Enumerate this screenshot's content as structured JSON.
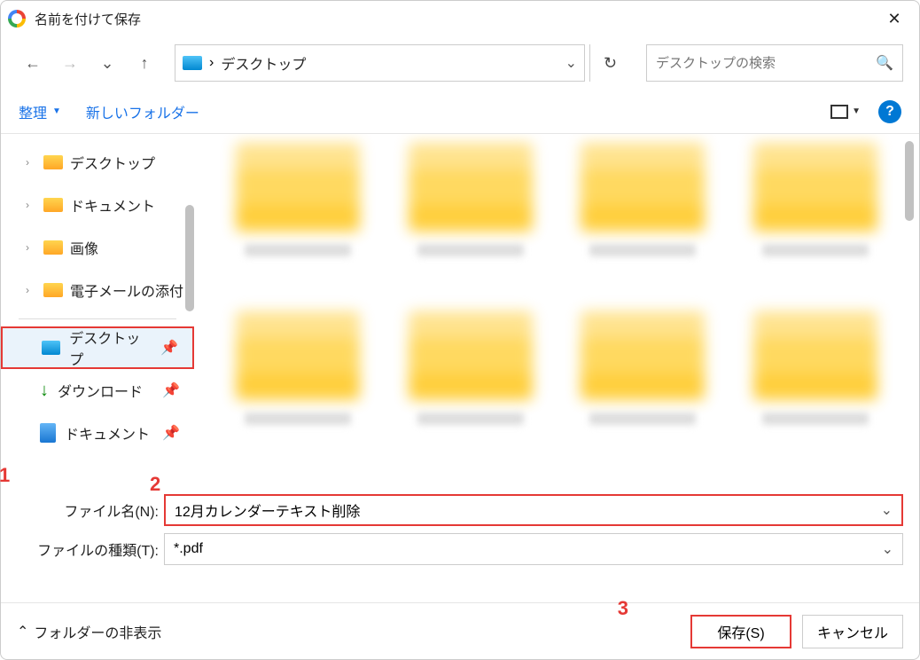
{
  "window": {
    "title": "名前を付けて保存"
  },
  "path": {
    "location": "デスクトップ",
    "chevron": "›"
  },
  "search": {
    "placeholder": "デスクトップの検索"
  },
  "toolbar": {
    "organize": "整理",
    "new_folder": "新しいフォルダー"
  },
  "tree": {
    "items": [
      {
        "label": "デスクトップ"
      },
      {
        "label": "ドキュメント"
      },
      {
        "label": "画像"
      },
      {
        "label": "電子メールの添付"
      }
    ]
  },
  "quick": {
    "items": [
      {
        "label": "デスクトップ"
      },
      {
        "label": "ダウンロード"
      },
      {
        "label": "ドキュメント"
      }
    ]
  },
  "fields": {
    "filename_label": "ファイル名(N):",
    "filename_value": "12月カレンダーテキスト削除",
    "filetype_label": "ファイルの種類(T):",
    "filetype_value": "*.pdf"
  },
  "footer": {
    "hide_folders": "フォルダーの非表示",
    "save": "保存(S)",
    "cancel": "キャンセル"
  },
  "annotations": {
    "a1": "1",
    "a2": "2",
    "a3": "3"
  }
}
